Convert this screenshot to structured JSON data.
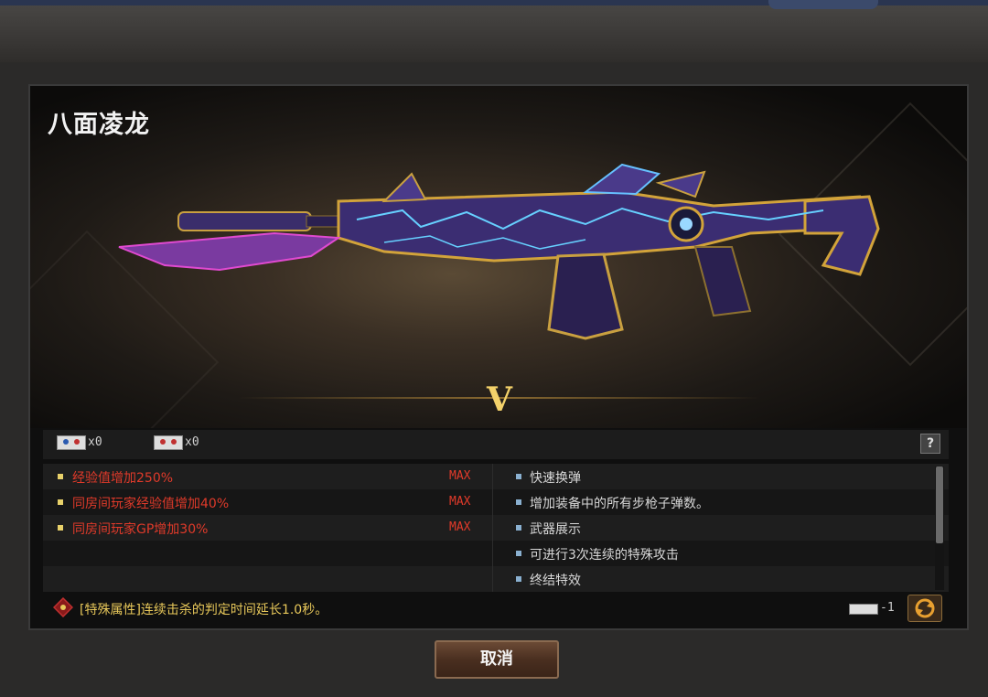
{
  "weapon": {
    "name": "八面凌龙",
    "grade": "V"
  },
  "currency": {
    "chip_a_count": "x0",
    "chip_b_count": "x0",
    "help": "?"
  },
  "attributes_left": [
    {
      "text": "经验值增加250%",
      "status": "MAX"
    },
    {
      "text": "同房间玩家经验值增加40%",
      "status": "MAX"
    },
    {
      "text": "同房间玩家GP增加30%",
      "status": "MAX"
    }
  ],
  "attributes_right": [
    "快速换弹",
    "增加装备中的所有步枪子弹数。",
    "武器展示",
    "可进行3次连续的特殊攻击",
    "终结特效"
  ],
  "special": {
    "text": "[特殊属性]连续击杀的判定时间延长1.0秒。"
  },
  "cost": {
    "value": "-1"
  },
  "buttons": {
    "cancel": "取消"
  },
  "colors": {
    "attribute_red": "#e03a2a",
    "special_gold": "#e8c85a",
    "grade_gold": "#f4d26a"
  }
}
